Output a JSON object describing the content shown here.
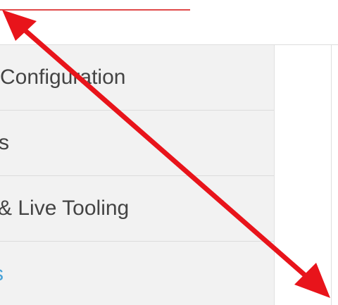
{
  "menu": {
    "items": [
      {
        "label": " Configuration"
      },
      {
        "label": "s"
      },
      {
        "label": "& Live Tooling"
      },
      {
        "label": "s"
      }
    ]
  },
  "annotation": {
    "arrow_color": "#e8141b",
    "accent_underline_color": "#e04a4a"
  }
}
